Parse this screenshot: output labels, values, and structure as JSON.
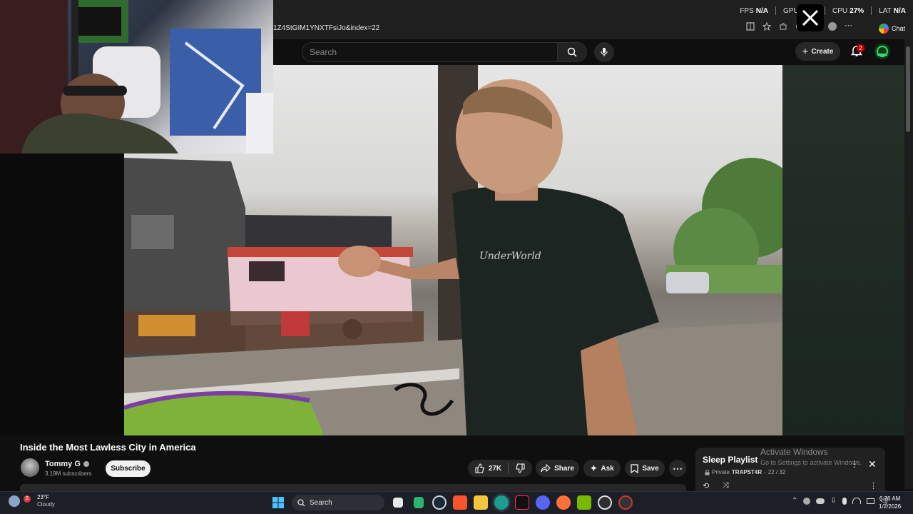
{
  "browser": {
    "url_partial": "1Z4StGIM1YNXTFsiJo&index=22",
    "chat_label": "Chat"
  },
  "perf_overlay": {
    "fps_label": "FPS",
    "fps_value": "N/A",
    "gpu_label": "GPU",
    "cpu_label": "CPU",
    "cpu_value": "27%",
    "lat_label": "LAT",
    "lat_value": "N/A"
  },
  "youtube_header": {
    "search_placeholder": "Search",
    "create_label": "Create",
    "notification_count": "2"
  },
  "video": {
    "title": "Inside the Most Lawless City in America",
    "shirt_text": "UnderWorld",
    "channel_name": "Tommy G",
    "subscribers": "3.19M subscribers",
    "subscribe_label": "Subscribe",
    "likes": "27K",
    "share_label": "Share",
    "ask_label": "Ask",
    "save_label": "Save"
  },
  "playlist": {
    "title": "Sleep Playlist",
    "privacy": "Private",
    "owner": "TRAPST4R",
    "position": "22 / 32"
  },
  "watermark": {
    "title": "Activate Windows",
    "subtitle": "Go to Settings to activate Windows."
  },
  "taskbar": {
    "weather_badge": "2",
    "temperature": "23°F",
    "condition": "Cloudy",
    "search_label": "Search",
    "time": "6:26 AM",
    "date": "1/2/2026"
  },
  "colors": {
    "youtube_bg": "#0f0f0f",
    "pill_bg": "#272727",
    "notification_red": "#cc0000",
    "taskbar_bg": "#1c1f26"
  }
}
